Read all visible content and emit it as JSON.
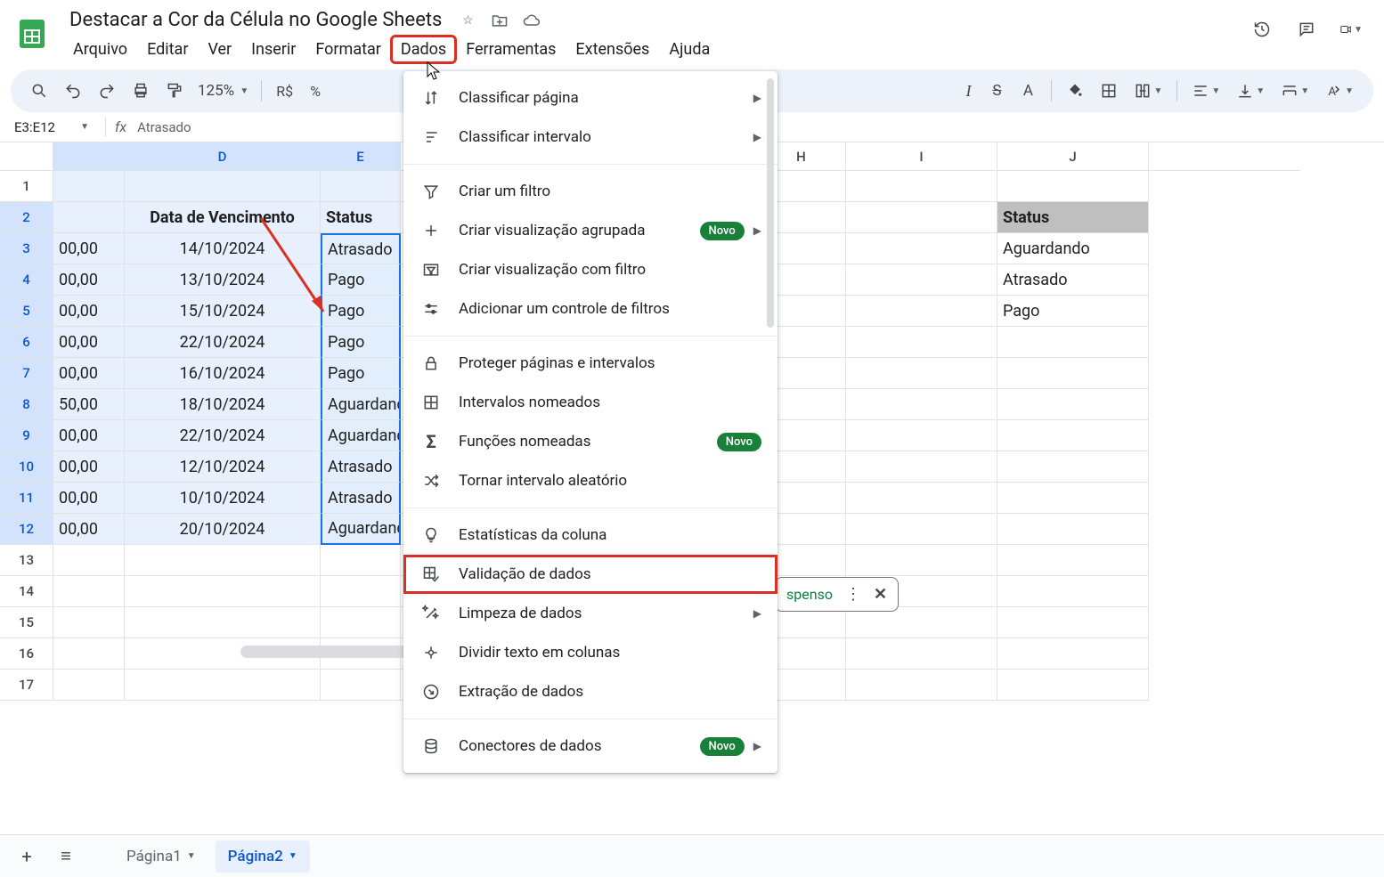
{
  "doc_title": "Destacar a Cor da Célula no Google Sheets",
  "menubar": [
    "Arquivo",
    "Editar",
    "Ver",
    "Inserir",
    "Formatar",
    "Dados",
    "Ferramentas",
    "Extensões",
    "Ajuda"
  ],
  "active_menu_index": 5,
  "toolbar": {
    "zoom": "125%",
    "currency": "R$",
    "percent": "%"
  },
  "namebox": "E3:E12",
  "formula_value": "Atrasado",
  "columns": [
    "",
    "D",
    "E",
    "",
    "H",
    "I",
    "J"
  ],
  "rows": [
    1,
    2,
    3,
    4,
    5,
    6,
    7,
    8,
    9,
    10,
    11,
    12,
    13,
    14,
    15,
    16,
    17
  ],
  "header_row": {
    "D": "Data de Vencimento",
    "E": "Status",
    "J": "Status"
  },
  "data": [
    {
      "amt": "00,00",
      "date": "14/10/2024",
      "status": "Atrasado",
      "j": "Aguardando"
    },
    {
      "amt": "00,00",
      "date": "13/10/2024",
      "status": "Pago",
      "j": "Atrasado"
    },
    {
      "amt": "00,00",
      "date": "15/10/2024",
      "status": "Pago",
      "j": "Pago"
    },
    {
      "amt": "00,00",
      "date": "22/10/2024",
      "status": "Pago",
      "j": ""
    },
    {
      "amt": "00,00",
      "date": "16/10/2024",
      "status": "Pago",
      "j": ""
    },
    {
      "amt": "50,00",
      "date": "18/10/2024",
      "status": "Aguardando",
      "j": ""
    },
    {
      "amt": "00,00",
      "date": "22/10/2024",
      "status": "Aguardando",
      "j": ""
    },
    {
      "amt": "00,00",
      "date": "12/10/2024",
      "status": "Atrasado",
      "j": ""
    },
    {
      "amt": "00,00",
      "date": "10/10/2024",
      "status": "Atrasado",
      "j": ""
    },
    {
      "amt": "00,00",
      "date": "20/10/2024",
      "status": "Aguardando",
      "j": ""
    }
  ],
  "dropdown": {
    "items": [
      {
        "icon": "sort-page",
        "label": "Classificar página",
        "arrow": true
      },
      {
        "icon": "sort-range",
        "label": "Classificar intervalo",
        "arrow": true
      },
      {
        "sep": true
      },
      {
        "icon": "filter",
        "label": "Criar um filtro"
      },
      {
        "icon": "plus",
        "label": "Criar visualização agrupada",
        "badge": "Novo",
        "arrow": true
      },
      {
        "icon": "filter-view",
        "label": "Criar visualização com filtro"
      },
      {
        "icon": "slider",
        "label": "Adicionar um controle de filtros"
      },
      {
        "sep": true
      },
      {
        "icon": "lock",
        "label": "Proteger páginas e intervalos"
      },
      {
        "icon": "grid",
        "label": "Intervalos nomeados"
      },
      {
        "icon": "sigma",
        "label": "Funções nomeadas",
        "badge": "Novo"
      },
      {
        "icon": "shuffle",
        "label": "Tornar intervalo aleatório"
      },
      {
        "sep": true
      },
      {
        "icon": "bulb",
        "label": "Estatísticas da coluna"
      },
      {
        "icon": "check-grid",
        "label": "Validação de dados",
        "highlight": true
      },
      {
        "icon": "wand",
        "label": "Limpeza de dados",
        "arrow": true
      },
      {
        "icon": "split",
        "label": "Dividir texto em colunas"
      },
      {
        "icon": "export",
        "label": "Extração de dados"
      },
      {
        "sep": true
      },
      {
        "icon": "db",
        "label": "Conectores de dados",
        "badge": "Novo",
        "arrow": true
      }
    ]
  },
  "chip_text": "spenso",
  "tabs": {
    "sheets": [
      "Página1",
      "Página2"
    ],
    "active": 1
  }
}
